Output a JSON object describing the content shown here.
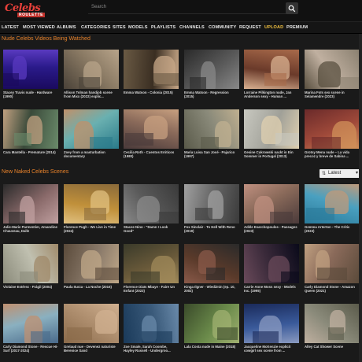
{
  "header": {
    "logo_top": "Celebs",
    "logo_bottom": "ROULETTE",
    "search_placeholder": "Search"
  },
  "nav": [
    {
      "label": "LATEST"
    },
    {
      "label": "MOST VIEWED"
    },
    {
      "label": "ALBUMS"
    },
    {
      "label": "CATEGORIES"
    },
    {
      "label": "SITES"
    },
    {
      "label": "MODELS"
    },
    {
      "label": "PLAYLISTS"
    },
    {
      "label": "CHANNELS"
    },
    {
      "label": "COMMUNITY"
    },
    {
      "label": "REQUEST"
    },
    {
      "label": "UPLOAD",
      "active": true
    },
    {
      "label": "PREMIUM"
    }
  ],
  "sections": {
    "watched_title": "Nude Celebs Videos Being Watched",
    "new_title": "New Naked Celebs Scenes",
    "sort_value": "Latest"
  },
  "watched": [
    {
      "title": "Stacey Travis nude - Hardware (1990)"
    },
    {
      "title": "Allison Tolman handjob scene from Mixx (2022) explic..."
    },
    {
      "title": "Emma Watson - Colonia (2015)"
    },
    {
      "title": "Emma Watson - Regression (2015)"
    },
    {
      "title": "Lorraine Pilkington nude, Jan Anderson sexy - Human ..."
    },
    {
      "title": "Marina Foïs sex scene in Selamendre (2023)"
    },
    {
      "title": "Cara Mantella - Premature (2014)"
    },
    {
      "title": "Zoey from a masturbation documentary"
    },
    {
      "title": "Cecilia Roth - Cuentos Eróticos (1980)"
    },
    {
      "title": "Maria Luisa San José - Pajarico (1997)"
    },
    {
      "title": "Gesine Cukrowski nackt in Ein Sommer in Portugal (2013)"
    },
    {
      "title": "Grotsy Mena nude – La vida precoz y breve de Sabina ..."
    }
  ],
  "new_scenes": [
    {
      "title": "Julie-Marie Parmentier, Amandine Chauveau, Dalle"
    },
    {
      "title": "Florence Pugh - We Live in Time (2024)"
    },
    {
      "title": "Stacee Nino - \"Damn I Look Good\""
    },
    {
      "title": "Fox Sinclair - To Hell With Reno (2019)"
    },
    {
      "title": "Adèle Exarchopoulos - Passages (2023)"
    },
    {
      "title": "Gemma Arterton - The Critic (2023)"
    },
    {
      "title": "Violaine Estérez - Frágil (2004)"
    },
    {
      "title": "Paula Iturza - La Noche (2016)"
    },
    {
      "title": "Florence Diaïs Mbaye - Faire Un Enfant (2023)"
    },
    {
      "title": "Kinga Ilgner - Wiedźmin (ep. 10, 2002)"
    },
    {
      "title": "Carrie Anne Moss sexy - Models Inc. (1995)"
    },
    {
      "title": "Carly Diamond Stone - Amazon Queen (2021)"
    },
    {
      "title": "Carly Diamond Stone - Rescue Hi-Surf (2017-2024)"
    },
    {
      "title": "Grelaud nue - Devenez naturiste Berenice Sand"
    },
    {
      "title": "Zoe Smale, Sarah Coombe, Hayley Russell - Undergroo..."
    },
    {
      "title": "Lala Costa nude in Maine (2018)"
    },
    {
      "title": "Jacqueline McKenzie explicit cowgirl sex scene from ..."
    },
    {
      "title": "Alley Cat Shower Scene"
    }
  ],
  "colors": {
    "accent": "#e8822a",
    "active_nav": "#f0c040",
    "bg": "#1a1a1a",
    "logo": "#e8403a"
  }
}
